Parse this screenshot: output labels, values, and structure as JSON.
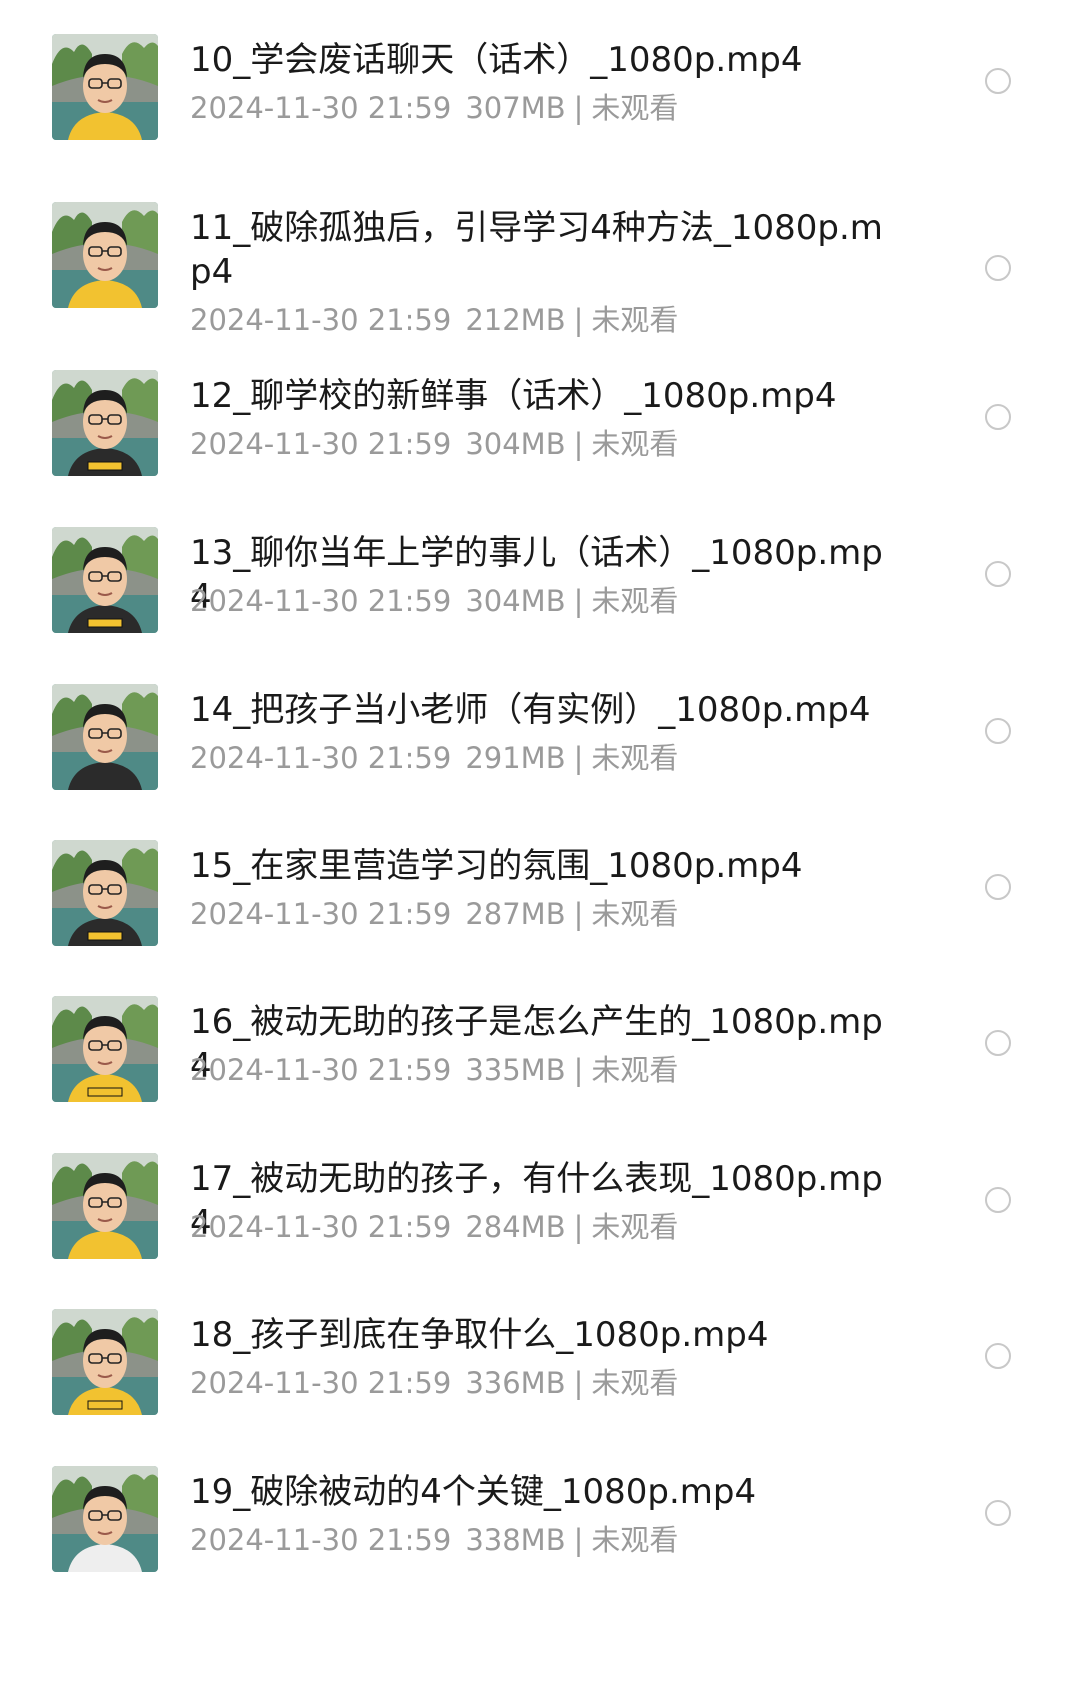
{
  "files": [
    {
      "title": "10_学会废话聊天（话术）_1080p.mp4",
      "date": "2024-11-30 21:59",
      "size": "307MB",
      "status": "未观看",
      "shirt_color": "#f2c230",
      "caption": ""
    },
    {
      "title": "11_破除孤独后，引导学习4种方法_1080p.mp4",
      "date": "2024-11-30 21:59",
      "size": "212MB",
      "status": "未观看",
      "shirt_color": "#f2c230",
      "caption": ""
    },
    {
      "title": "12_聊学校的新鲜事（话术）_1080p.mp4",
      "date": "2024-11-30 21:59",
      "size": "304MB",
      "status": "未观看",
      "shirt_color": "#2b2b2b",
      "caption": "yes"
    },
    {
      "title": "13_聊你当年上学的事儿（话术）_1080p.mp4",
      "date": "2024-11-30 21:59",
      "size": "304MB",
      "status": "未观看",
      "shirt_color": "#2b2b2b",
      "caption": "yes"
    },
    {
      "title": "14_把孩子当小老师（有实例）_1080p.mp4",
      "date": "2024-11-30 21:59",
      "size": "291MB",
      "status": "未观看",
      "shirt_color": "#2b2b2b",
      "caption": ""
    },
    {
      "title": "15_在家里营造学习的氛围_1080p.mp4",
      "date": "2024-11-30 21:59",
      "size": "287MB",
      "status": "未观看",
      "shirt_color": "#2b2b2b",
      "caption": "yes"
    },
    {
      "title": "16_被动无助的孩子是怎么产生的_1080p.mp4",
      "date": "2024-11-30 21:59",
      "size": "335MB",
      "status": "未观看",
      "shirt_color": "#f2c230",
      "caption": "yes"
    },
    {
      "title": "17_被动无助的孩子，有什么表现_1080p.mp4",
      "date": "2024-11-30 21:59",
      "size": "284MB",
      "status": "未观看",
      "shirt_color": "#f2c230",
      "caption": ""
    },
    {
      "title": "18_孩子到底在争取什么_1080p.mp4",
      "date": "2024-11-30 21:59",
      "size": "336MB",
      "status": "未观看",
      "shirt_color": "#f2c230",
      "caption": "yes"
    },
    {
      "title": "19_破除被动的4个关键_1080p.mp4",
      "date": "2024-11-30 21:59",
      "size": "338MB",
      "status": "未观看",
      "shirt_color": "#eeeeee",
      "caption": ""
    }
  ],
  "colors": {
    "title_text": "#1a1a1a",
    "meta_text": "#9a9a9a",
    "radio_border": "#c8c8c8",
    "background": "#ffffff"
  },
  "icons": {
    "thumbnail": "video-thumbnail-icon",
    "select": "radio-unchecked-icon"
  }
}
